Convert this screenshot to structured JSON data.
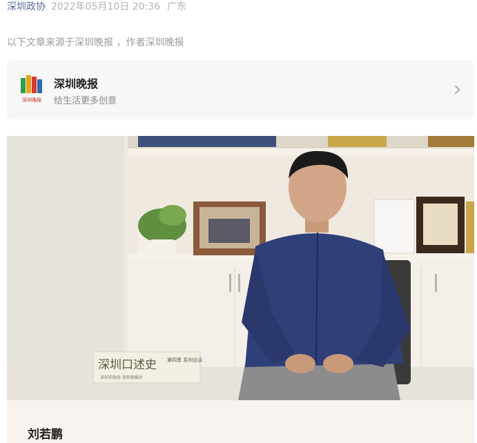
{
  "meta": {
    "author": "深圳政协",
    "date": "2022年05月10日 20:36",
    "location": "广东"
  },
  "source_note": "以下文章来源于深圳晚报 ，作者深圳晚报",
  "account": {
    "name": "深圳晚报",
    "description": "给生活更多创意",
    "logo_text": "深圳晚报",
    "logo_colors": [
      "#2e9e4a",
      "#e6a21a",
      "#d83a2e",
      "#2b6cb0"
    ]
  },
  "photo": {
    "plaque_title": "深圳口述史",
    "plaque_subtitle": "第四季 系列访谈",
    "plaque_footer": "深圳市政协  深圳商报社"
  },
  "caption": {
    "name": "刘若鹏"
  }
}
